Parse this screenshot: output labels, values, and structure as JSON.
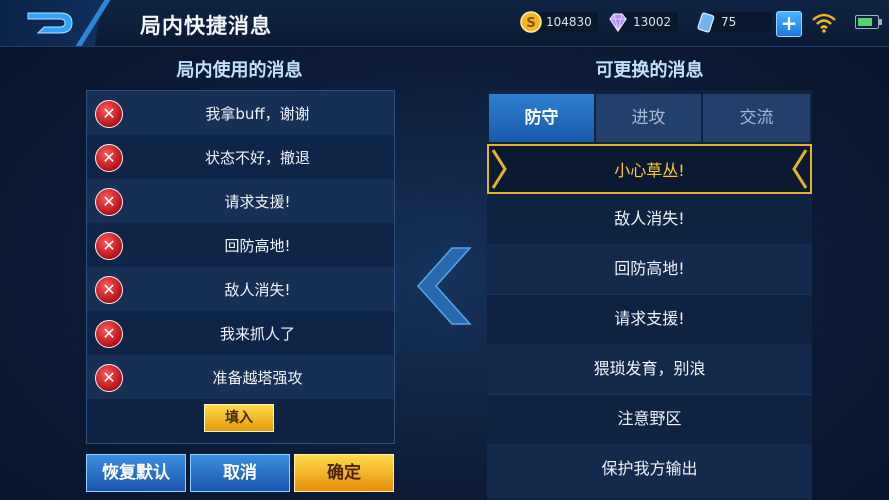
{
  "header": {
    "title": "局内快捷消息",
    "back_icon": "back-arrow-icon",
    "resources": [
      {
        "icon": "gold-coin-icon",
        "value": "104830"
      },
      {
        "icon": "diamond-icon",
        "value": "13002"
      },
      {
        "icon": "voucher-icon",
        "value": "75"
      }
    ],
    "add_icon": "plus-icon",
    "status_icons": [
      "wifi-icon",
      "battery-icon"
    ]
  },
  "left_panel": {
    "title": "局内使用的消息",
    "items": [
      {
        "text": "我拿buff，谢谢"
      },
      {
        "text": "状态不好，撤退"
      },
      {
        "text": "请求支援!"
      },
      {
        "text": "回防高地!"
      },
      {
        "text": "敌人消失!"
      },
      {
        "text": "我来抓人了"
      },
      {
        "text": "准备越塔强攻"
      }
    ],
    "fill_button": "填入"
  },
  "buttons": {
    "reset": "恢复默认",
    "cancel": "取消",
    "confirm": "确定"
  },
  "right_panel": {
    "title": "可更换的消息",
    "tabs": [
      {
        "label": "防守",
        "active": true
      },
      {
        "label": "进攻",
        "active": false
      },
      {
        "label": "交流",
        "active": false
      }
    ],
    "items": [
      {
        "text": "小心草丛!",
        "selected": true
      },
      {
        "text": "敌人消失!"
      },
      {
        "text": "回防高地!"
      },
      {
        "text": "请求支援!"
      },
      {
        "text": "猥琐发育，别浪"
      },
      {
        "text": "注意野区"
      },
      {
        "text": "保护我方输出"
      }
    ]
  },
  "colors": {
    "accent_blue": "#2f7fd2",
    "gold": "#ffc83a",
    "delete_red": "#c8141e"
  }
}
